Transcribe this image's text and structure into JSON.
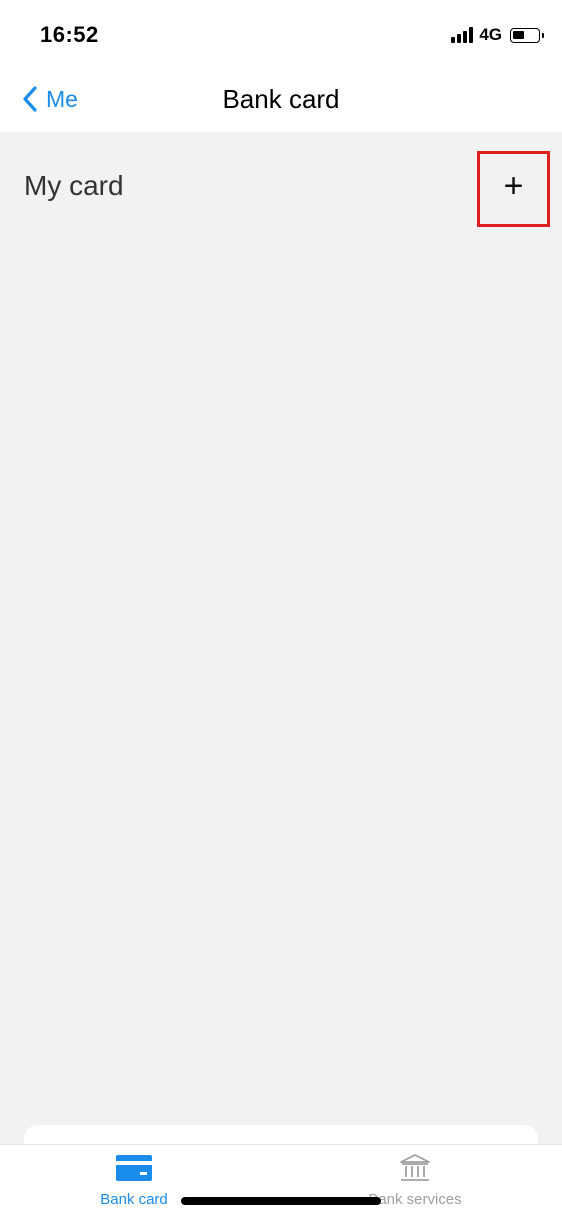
{
  "status_bar": {
    "time": "16:52",
    "network": "4G",
    "battery_level": 0.45
  },
  "nav": {
    "back_label": "Me",
    "title": "Bank card"
  },
  "section": {
    "title": "My card",
    "add_label": "+"
  },
  "tabs": [
    {
      "label": "Bank card",
      "icon": "card-icon",
      "active": true
    },
    {
      "label": "Bank services",
      "icon": "bank-icon",
      "active": false
    }
  ],
  "colors": {
    "accent": "#1a8cec",
    "inactive": "#a0a0a0",
    "background": "#f2f2f2",
    "highlight": "#e0201e"
  }
}
